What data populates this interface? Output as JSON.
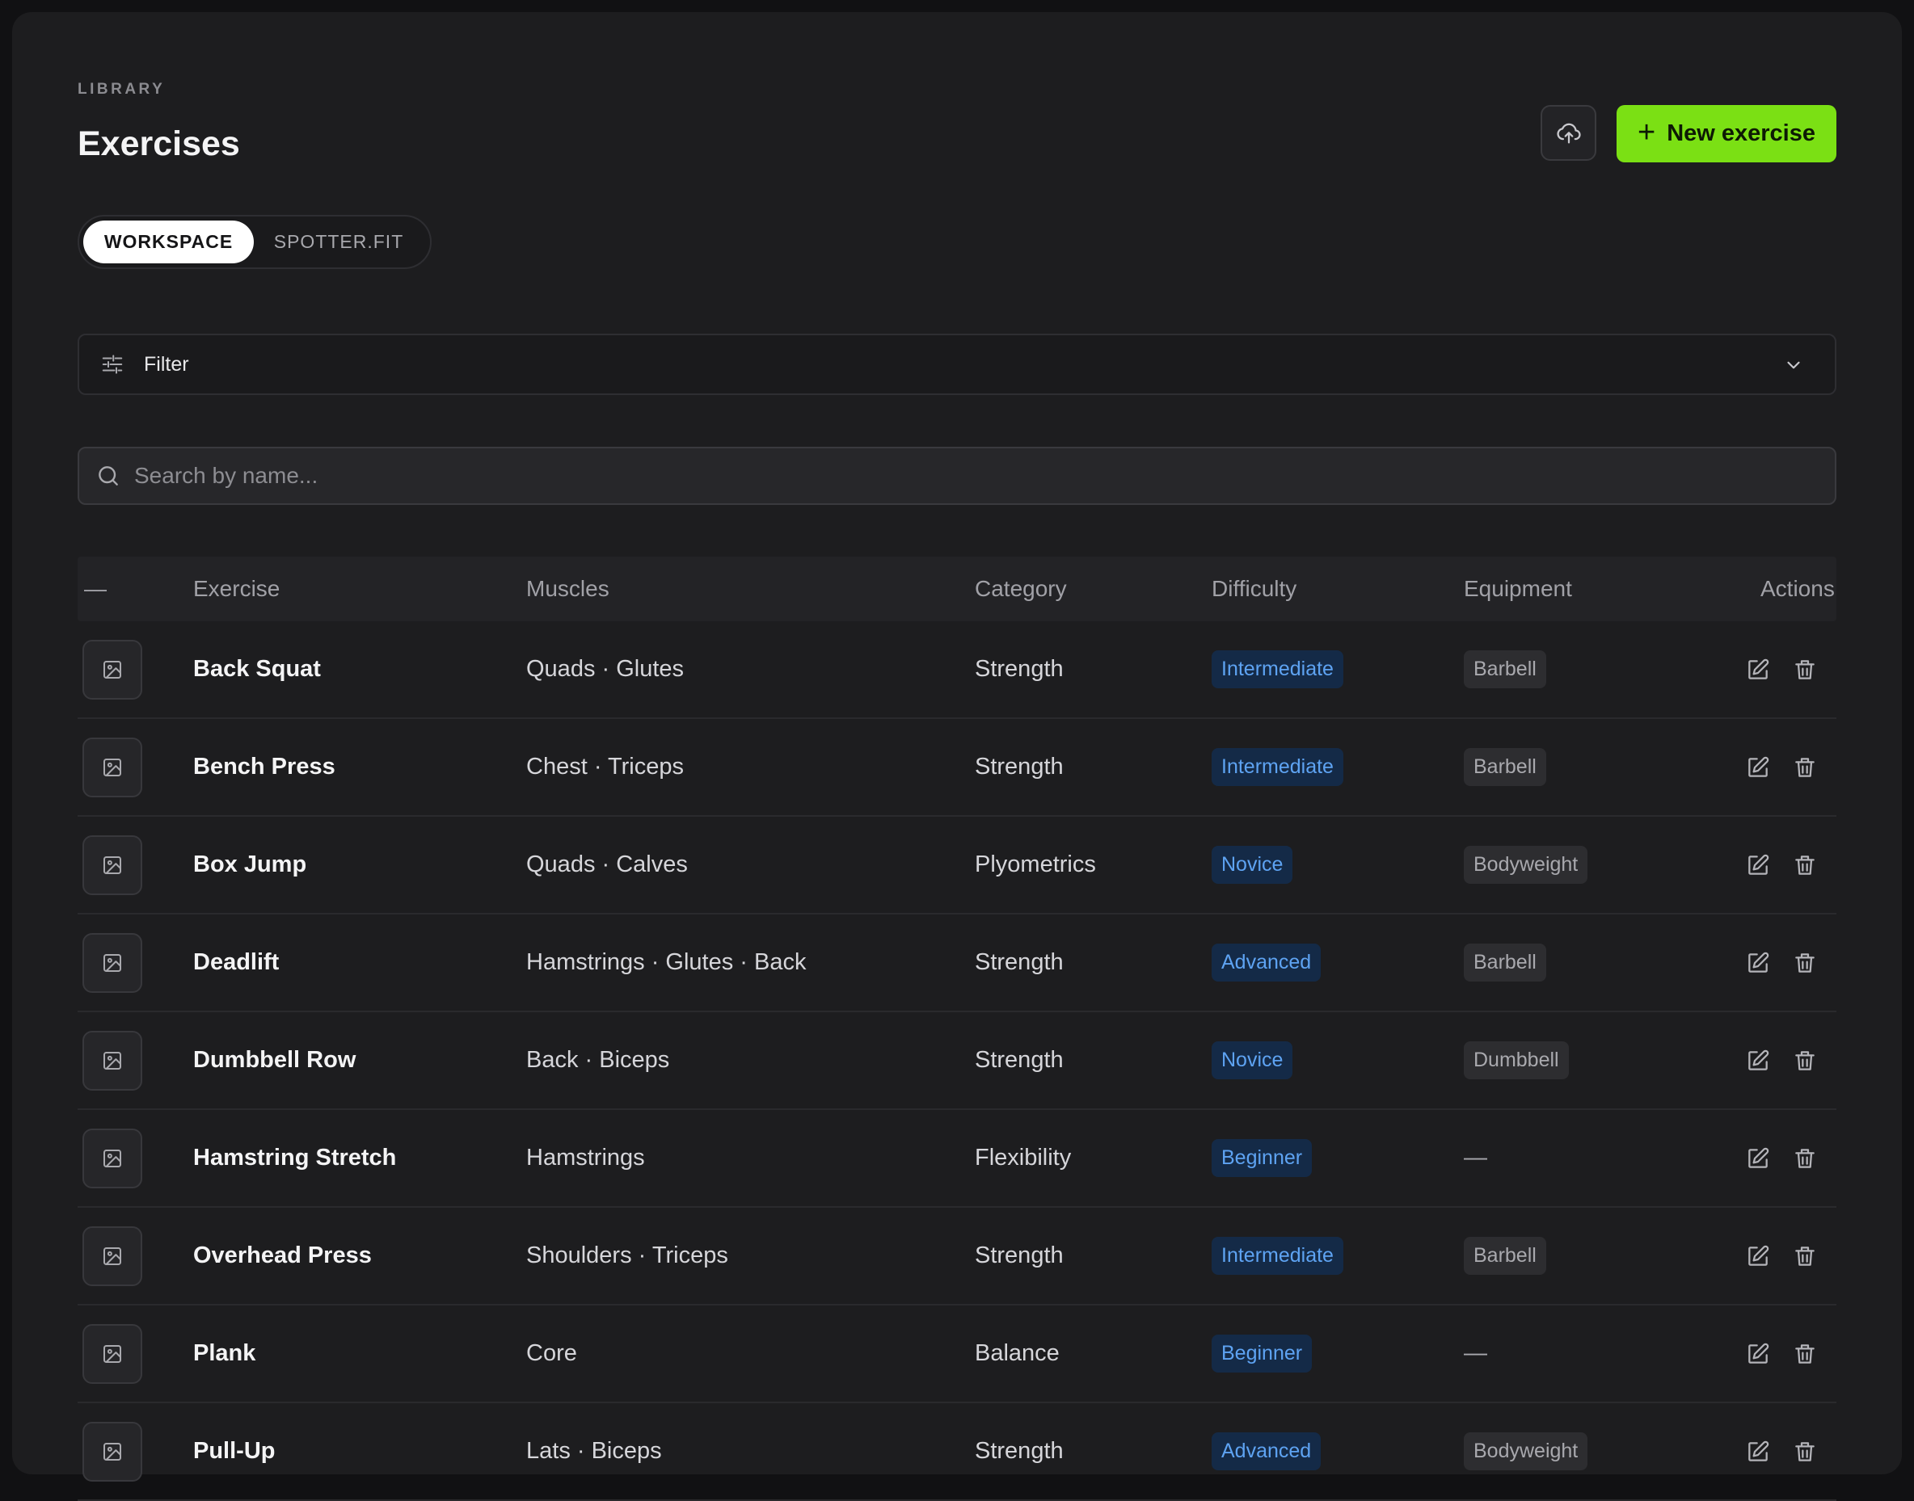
{
  "header": {
    "eyebrow": "LIBRARY",
    "title": "Exercises",
    "new_button_label": "New exercise",
    "upload_icon": "cloud-upload-icon"
  },
  "scope_toggle": {
    "options": [
      "WORKSPACE",
      "SPOTTER.FIT"
    ],
    "selected": "WORKSPACE"
  },
  "filter": {
    "label": "Filter"
  },
  "search": {
    "placeholder": "Search by name...",
    "value": ""
  },
  "table": {
    "select_header": "—",
    "columns": [
      "Exercise",
      "Muscles",
      "Category",
      "Difficulty",
      "Equipment",
      "Actions"
    ],
    "rows": [
      {
        "name": "Back Squat",
        "muscles": "Quads · Glutes",
        "category": "Strength",
        "difficulty": "Intermediate",
        "equipment": "Barbell"
      },
      {
        "name": "Bench Press",
        "muscles": "Chest · Triceps",
        "category": "Strength",
        "difficulty": "Intermediate",
        "equipment": "Barbell"
      },
      {
        "name": "Box Jump",
        "muscles": "Quads · Calves",
        "category": "Plyometrics",
        "difficulty": "Novice",
        "equipment": "Bodyweight"
      },
      {
        "name": "Deadlift",
        "muscles": "Hamstrings · Glutes · Back",
        "category": "Strength",
        "difficulty": "Advanced",
        "equipment": "Barbell"
      },
      {
        "name": "Dumbbell Row",
        "muscles": "Back · Biceps",
        "category": "Strength",
        "difficulty": "Novice",
        "equipment": "Dumbbell"
      },
      {
        "name": "Hamstring Stretch",
        "muscles": "Hamstrings",
        "category": "Flexibility",
        "difficulty": "Beginner",
        "equipment": "—"
      },
      {
        "name": "Overhead Press",
        "muscles": "Shoulders · Triceps",
        "category": "Strength",
        "difficulty": "Intermediate",
        "equipment": "Barbell"
      },
      {
        "name": "Plank",
        "muscles": "Core",
        "category": "Balance",
        "difficulty": "Beginner",
        "equipment": "—"
      },
      {
        "name": "Pull-Up",
        "muscles": "Lats · Biceps",
        "category": "Strength",
        "difficulty": "Advanced",
        "equipment": "Bodyweight"
      }
    ]
  },
  "colors": {
    "accent": "#7be014",
    "background": "#1d1d1f",
    "difficulty_badge_bg": "#142a47",
    "difficulty_badge_text": "#5ea3f2"
  }
}
